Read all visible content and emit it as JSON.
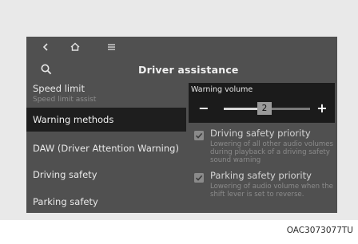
{
  "screen": {
    "title": "Driver assistance"
  },
  "menu": {
    "items": [
      {
        "label": "Speed limit",
        "sublabel": "Speed limit assist"
      },
      {
        "label": "Warning methods"
      },
      {
        "label": "DAW (Driver Attention Warning)"
      },
      {
        "label": "Driving safety"
      },
      {
        "label": "Parking safety"
      }
    ],
    "selected": "Warning methods"
  },
  "warning_volume": {
    "title": "Warning volume",
    "minus": "−",
    "plus": "+",
    "value": "2",
    "level_fraction": 0.45
  },
  "options": {
    "driving_safety_priority": {
      "label": "Driving safety priority",
      "checked": true,
      "description": "Lowering of all other audio volumes during playback of a driving safety sound warning"
    },
    "parking_safety_priority": {
      "label": "Parking safety priority",
      "checked": true,
      "description": "Lowering of audio volume when the shift lever is set to reverse."
    }
  },
  "caption": "OAC3073077TU",
  "icons": [
    "back-icon",
    "home-icon",
    "menu-icon",
    "search-icon",
    "checkbox-icon"
  ],
  "colors": {
    "screen_bg": "#505050",
    "selected_bg": "#1e1e1e",
    "popup_bg": "#1b1b1b"
  }
}
